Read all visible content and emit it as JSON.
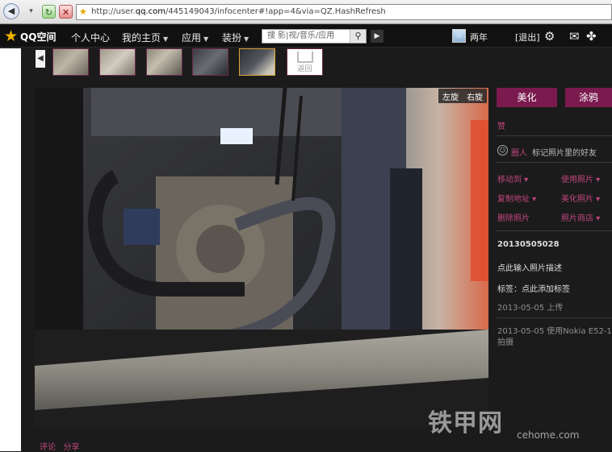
{
  "browser": {
    "url_prefix": "http://user.",
    "url_host": "qq.com",
    "url_suffix": "/445149043/infocenter#!app=4&via=QZ.HashRefresh"
  },
  "topnav": {
    "logo_text": "QQ空间",
    "items": [
      "个人中心",
      "我的主页",
      "应用",
      "装扮"
    ],
    "search_placeholder": "搜 影|视/音乐/应用",
    "username": "两年",
    "logout": "[退出]"
  },
  "thumbs": {
    "return_label": "返回"
  },
  "photo": {
    "rotate_left": "左旋",
    "rotate_right": "右旋"
  },
  "panel": {
    "beautify": "美化",
    "doodle": "涂鸦",
    "like": "赞",
    "circle_person": "圈人",
    "circle_hint": "标记照片里的好友",
    "move_to": "移动到",
    "use_photo": "使用照片",
    "copy_addr": "复制地址",
    "beautify_photo": "美化照片",
    "delete_photo": "删除照片",
    "photo_shop": "照片商店",
    "photo_name": "20130505028",
    "add_desc": "点此输入照片描述",
    "tags": "标签：点此添加标签",
    "upload_date": "2013-05-05  上传",
    "shot_info": "2013-05-05 使用Nokia E52-1拍摄"
  },
  "bottom": {
    "comment": "评论",
    "share": "分享"
  },
  "watermark": {
    "brand": "铁甲网",
    "domain": "cehome.com"
  }
}
